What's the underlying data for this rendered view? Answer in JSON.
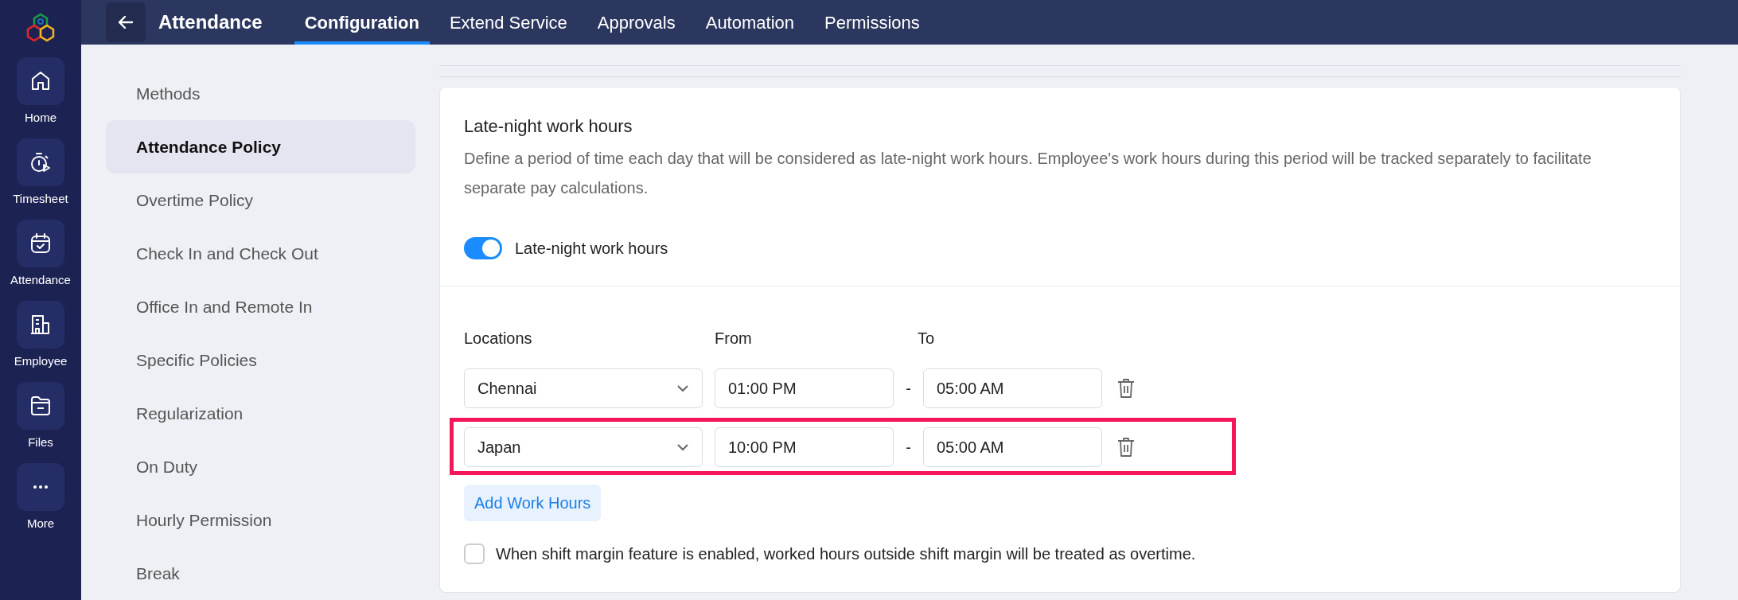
{
  "rail": [
    {
      "label": "Home"
    },
    {
      "label": "Timesheet"
    },
    {
      "label": "Attendance"
    },
    {
      "label": "Employee"
    },
    {
      "label": "Files"
    },
    {
      "label": "More"
    }
  ],
  "header": {
    "title": "Attendance",
    "tabs": [
      {
        "label": "Configuration",
        "selected": true
      },
      {
        "label": "Extend Service",
        "selected": false
      },
      {
        "label": "Approvals",
        "selected": false
      },
      {
        "label": "Automation",
        "selected": false
      },
      {
        "label": "Permissions",
        "selected": false
      }
    ]
  },
  "menu": [
    {
      "label": "Methods",
      "selected": false
    },
    {
      "label": "Attendance Policy",
      "selected": true
    },
    {
      "label": "Overtime Policy",
      "selected": false
    },
    {
      "label": "Check In and Check Out",
      "selected": false
    },
    {
      "label": "Office In and Remote In",
      "selected": false
    },
    {
      "label": "Specific Policies",
      "selected": false
    },
    {
      "label": "Regularization",
      "selected": false
    },
    {
      "label": "On Duty",
      "selected": false
    },
    {
      "label": "Hourly Permission",
      "selected": false
    },
    {
      "label": "Break",
      "selected": false
    }
  ],
  "section": {
    "title": "Late-night work hours",
    "description": "Define a period of time each day that will be considered as late-night work hours. Employee's work hours during this period will be tracked separately to facilitate separate pay calculations.",
    "toggle": {
      "label": "Late-night work hours",
      "on": true
    },
    "columns": [
      "Locations",
      "From",
      "To"
    ],
    "rows": [
      {
        "location": "Chennai",
        "from": "01:00 PM",
        "separator": "-",
        "to": "05:00 AM",
        "highlighted": false
      },
      {
        "location": "Japan",
        "from": "10:00 PM",
        "separator": "-",
        "to": "05:00 AM",
        "highlighted": true
      }
    ],
    "add_button": "Add Work Hours",
    "checkbox": {
      "label": "When shift margin feature is enabled, worked hours outside shift margin will be treated as overtime.",
      "checked": false
    }
  }
}
